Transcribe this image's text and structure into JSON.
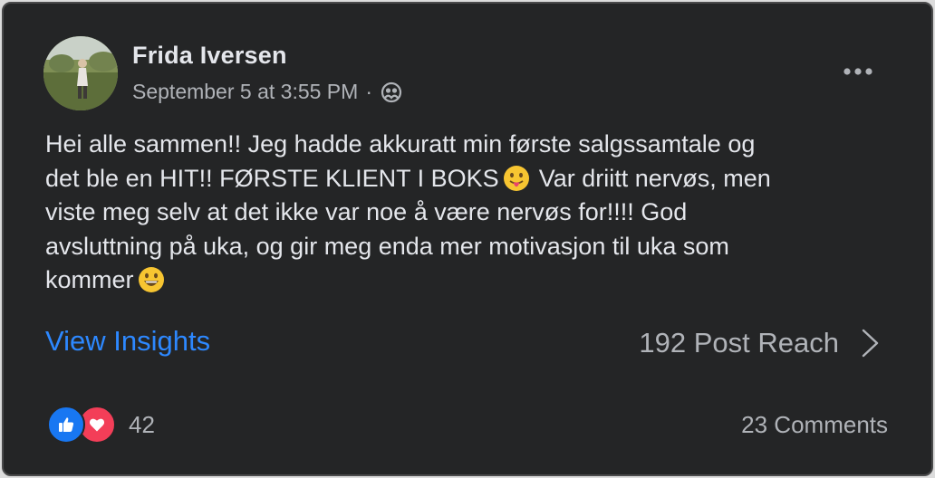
{
  "post": {
    "author": "Frida Iversen",
    "date": "September 5 at 3:55 PM",
    "separator": "·",
    "audience_icon": "friends-icon",
    "body_lines": [
      "Hei alle sammen!! Jeg hadde akkuratt min første salgssamtale og",
      "det ble en HIT!! FØRSTE KLIENT I BOKS",
      "Var driitt nervøs, men",
      "viste meg selv at det ikke var noe å være nervøs for!!!! God",
      "avsluttning på uka, og gir meg enda mer motivasjon til uka som",
      "kommer"
    ],
    "emojis": [
      "tongue-out-emoji",
      "grinning-emoji"
    ]
  },
  "insights": {
    "label": "View Insights",
    "reach": "192 Post Reach"
  },
  "footer": {
    "reaction_icons": [
      "like-icon",
      "love-icon"
    ],
    "reaction_count": "42",
    "comments": "23 Comments"
  },
  "colors": {
    "background": "#242526",
    "text": "#e4e6eb",
    "secondary": "#b0b3b8",
    "link": "#2d88ff",
    "like": "#1877f2",
    "love": "#f33e58"
  }
}
